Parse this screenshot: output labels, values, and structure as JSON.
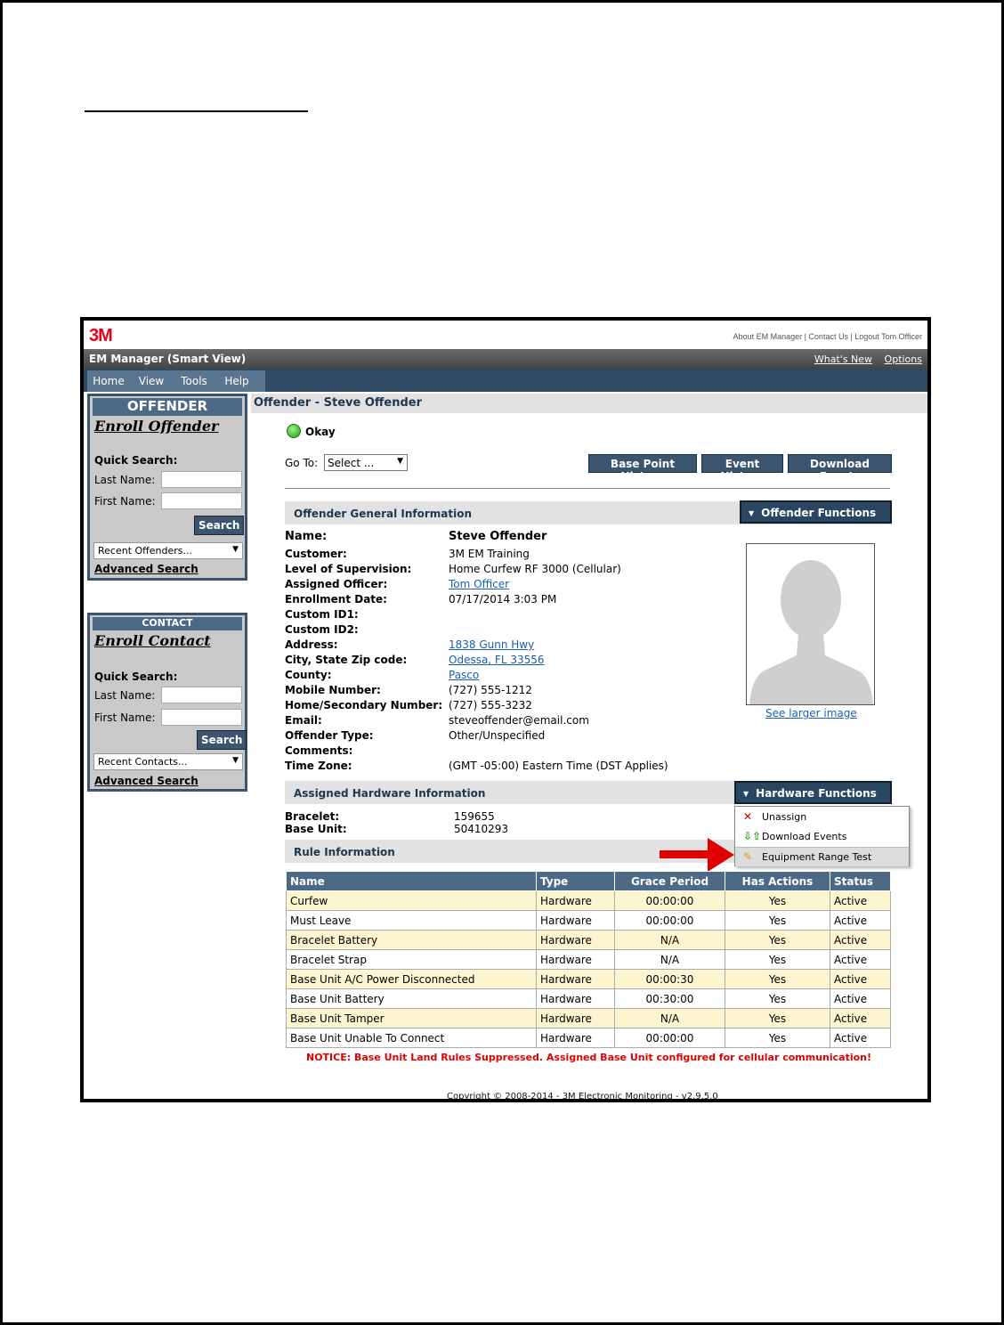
{
  "app": {
    "logo": "3M",
    "top_links": "About EM Manager | Contact Us | Logout Tom Officer",
    "title": "EM Manager (Smart View)",
    "whats_new": "What's New",
    "options": "Options"
  },
  "menu": [
    "Home",
    "View",
    "Tools",
    "Help"
  ],
  "sidebar": {
    "offender": {
      "header": "OFFENDER",
      "enroll": "Enroll Offender",
      "quick_search": "Quick Search:",
      "last_name_label": "Last Name:",
      "first_name_label": "First Name:",
      "search_button": "Search",
      "recent": "Recent Offenders...",
      "advanced": "Advanced Search"
    },
    "contact": {
      "header": "CONTACT",
      "enroll": "Enroll Contact",
      "quick_search": "Quick Search:",
      "last_name_label": "Last Name:",
      "first_name_label": "First Name:",
      "search_button": "Search",
      "recent": "Recent Contacts...",
      "advanced": "Advanced Search"
    }
  },
  "main": {
    "header": "Offender - Steve Offender",
    "status": "Okay",
    "goto_label": "Go To:",
    "goto_value": "Select ...",
    "buttons": {
      "base_point_history": "Base Point History",
      "event_history": "Event History",
      "download_events": "Download Events"
    },
    "general_section": "Offender General Information",
    "offender_functions": "Offender Functions",
    "info": [
      {
        "label": "Name:",
        "value": "Steve Offender"
      },
      {
        "label": "Customer:",
        "value": "3M EM Training"
      },
      {
        "label": "Level of Supervision:",
        "value": "Home Curfew RF 3000 (Cellular)"
      },
      {
        "label": "Assigned Officer:",
        "value": "Tom Officer"
      },
      {
        "label": "Enrollment Date:",
        "value": "07/17/2014 3:03 PM"
      },
      {
        "label": "Custom ID1:",
        "value": ""
      },
      {
        "label": "Custom ID2:",
        "value": ""
      },
      {
        "label": "Address:",
        "value": "1838 Gunn Hwy"
      },
      {
        "label": "City, State Zip code:",
        "value": "Odessa, FL 33556"
      },
      {
        "label": "County:",
        "value": "Pasco"
      },
      {
        "label": "Mobile Number:",
        "value": "(727) 555-1212"
      },
      {
        "label": "Home/Secondary Number:",
        "value": "(727) 555-3232"
      },
      {
        "label": "Email:",
        "value": "steveoffender@email.com"
      },
      {
        "label": "Offender Type:",
        "value": "Other/Unspecified"
      },
      {
        "label": "Comments:",
        "value": ""
      },
      {
        "label": "Time Zone:",
        "value": "(GMT -05:00) Eastern Time (DST Applies)"
      }
    ],
    "see_larger": "See larger image",
    "hardware_section": "Assigned Hardware Information",
    "hardware_functions": "Hardware Functions",
    "hardware": [
      {
        "label": "Bracelet:",
        "value": "159655"
      },
      {
        "label": "Base Unit:",
        "value": "50410293"
      }
    ],
    "hardware_menu": [
      {
        "icon": "x-icon",
        "label": "Unassign"
      },
      {
        "icon": "download-arrows-icon",
        "label": "Download Events"
      },
      {
        "icon": "pencil-icon",
        "label": "Equipment Range Test"
      }
    ],
    "rule_section": "Rule Information",
    "rules_columns": [
      "Name",
      "Type",
      "Grace Period",
      "Has Actions",
      "Status"
    ],
    "rules": [
      [
        "Curfew",
        "Hardware",
        "00:00:00",
        "Yes",
        "Active"
      ],
      [
        "Must Leave",
        "Hardware",
        "00:00:00",
        "Yes",
        "Active"
      ],
      [
        "Bracelet Battery",
        "Hardware",
        "N/A",
        "Yes",
        "Active"
      ],
      [
        "Bracelet Strap",
        "Hardware",
        "N/A",
        "Yes",
        "Active"
      ],
      [
        "Base Unit A/C Power Disconnected",
        "Hardware",
        "00:00:30",
        "Yes",
        "Active"
      ],
      [
        "Base Unit Battery",
        "Hardware",
        "00:30:00",
        "Yes",
        "Active"
      ],
      [
        "Base Unit Tamper",
        "Hardware",
        "N/A",
        "Yes",
        "Active"
      ],
      [
        "Base Unit Unable To Connect",
        "Hardware",
        "00:00:00",
        "Yes",
        "Active"
      ]
    ],
    "notice": "NOTICE: Base Unit Land Rules Suppressed. Assigned Base Unit configured for cellular communication!",
    "copyright": "Copyright © 2008-2014 - 3M Electronic Monitoring - v2.9.5.0"
  },
  "colors": {
    "brand_red": "#e8001c",
    "nav_blue": "#2f4a63",
    "header_blue": "#4c6985",
    "row_highlight": "#fcf5cf",
    "notice_red": "#e00000",
    "link_blue": "#1a5fb4"
  }
}
